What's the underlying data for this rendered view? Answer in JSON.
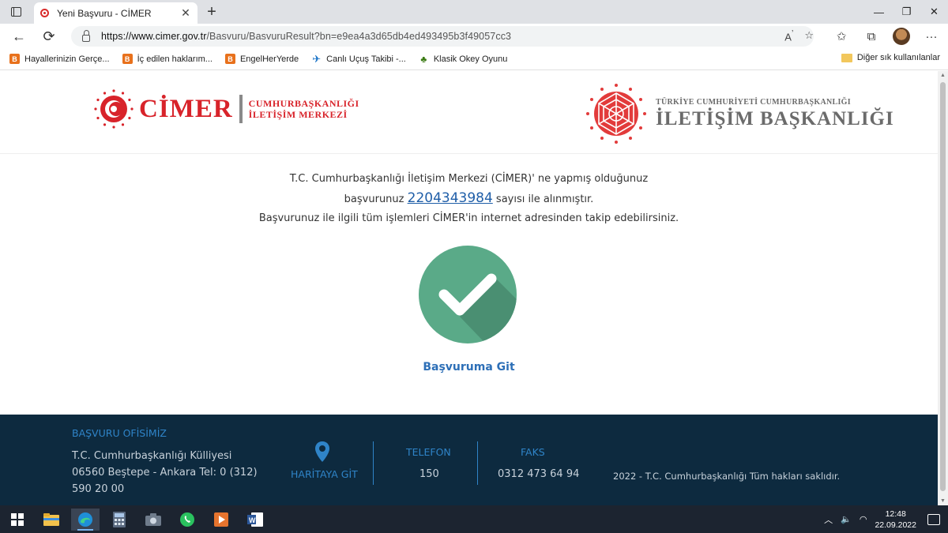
{
  "browser": {
    "tab_title": "Yeni Başvuru - CİMER",
    "tab_close": "✕",
    "new_tab": "+",
    "url_prefix": "https://www.cimer.gov.tr",
    "url_rest": "/Basvuru/BasvuruResult?bn=e9ea4a3d65db4ed493495b3f49057cc3",
    "bookmarks": [
      {
        "label": "Hayallerinizin Gerçe..."
      },
      {
        "label": "İç edilen haklarım..."
      },
      {
        "label": "EngelHerYerde"
      },
      {
        "label": "Canlı Uçuş Takibi -..."
      },
      {
        "label": "Klasik Okey Oyunu"
      }
    ],
    "other_bookmarks": "Diğer sık kullanılanlar"
  },
  "header": {
    "cimer_word": "CİMER",
    "cimer_sub_line1": "CUMHURBAŞKANLIĞI",
    "cimer_sub_line2": "İLETİŞİM MERKEZİ",
    "ib_small": "TÜRKİYE CUMHURİYETİ CUMHURBAŞKANLIĞI",
    "ib_big": "İLETİŞİM BAŞKANLIĞI"
  },
  "main": {
    "line1": "T.C. Cumhurbaşkanlığı İletişim Merkezi (CİMER)' ne yapmış olduğunuz",
    "line2_before": "başvurunuz ",
    "application_number": "2204343984",
    "line2_after": " sayısı ile alınmıştır.",
    "line3": "Başvurunuz ile ilgili tüm işlemleri CİMER'in internet adresinden takip edebilirsiniz.",
    "goto_button": "Başvuruma Git",
    "check_color": "#5aaa88"
  },
  "footer": {
    "office_title": "BAŞVURU OFİSİMİZ",
    "office_text": "T.C. Cumhurbaşkanlığı Külliyesi 06560 Beştepe - Ankara Tel: 0 (312) 590 20 00",
    "map_link": "HARİTAYA GİT",
    "phone_title": "TELEFON",
    "phone_value": "150",
    "fax_title": "FAKS",
    "fax_value": "0312 473 64 94",
    "copyright": "2022 - T.C. Cumhurbaşkanlığı Tüm hakları saklıdır."
  },
  "taskbar": {
    "time": "12:48",
    "date": "22.09.2022"
  }
}
